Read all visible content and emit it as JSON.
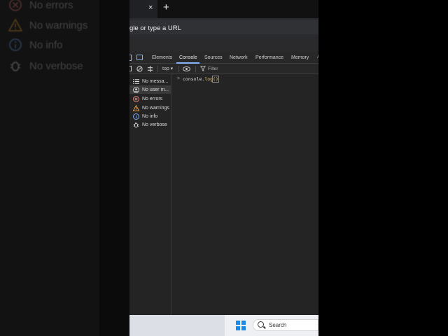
{
  "background": {
    "items": [
      {
        "label": "No errors",
        "icon": "error-icon"
      },
      {
        "label": "No warnings",
        "icon": "warning-icon"
      },
      {
        "label": "No info",
        "icon": "info-icon"
      },
      {
        "label": "No verbose",
        "icon": "bug-icon"
      }
    ]
  },
  "browser": {
    "tab_close": "×",
    "new_tab": "+",
    "address_text": "gle or type a URL"
  },
  "devtools": {
    "tabs": [
      {
        "label": "Elements",
        "active": false
      },
      {
        "label": "Console",
        "active": true
      },
      {
        "label": "Sources",
        "active": false
      },
      {
        "label": "Network",
        "active": false
      },
      {
        "label": "Performance",
        "active": false
      },
      {
        "label": "Memory",
        "active": false
      }
    ],
    "toolbar": {
      "context": "top ▾",
      "filter_placeholder": "Filter"
    },
    "sidebar": {
      "items": [
        {
          "label": "No messa...",
          "icon": "list-icon",
          "selected": false
        },
        {
          "label": "No user m...",
          "icon": "user-icon",
          "selected": true
        },
        {
          "label": "No errors",
          "icon": "error-icon",
          "selected": false
        },
        {
          "label": "No warnings",
          "icon": "warning-icon",
          "selected": false
        },
        {
          "label": "No info",
          "icon": "info-icon",
          "selected": false
        },
        {
          "label": "No verbose",
          "icon": "bug-icon",
          "selected": false
        }
      ]
    },
    "console": {
      "prompt": ">",
      "input_prefix": "console.",
      "input_fn": "log",
      "input_parens": "()"
    }
  },
  "taskbar": {
    "search_label": "Search"
  },
  "colors": {
    "accent": "#8ab4f8",
    "error": "#f28b82",
    "warning": "#fdd663",
    "info": "#8ab4f8",
    "windows_blue": "#1e88e5"
  }
}
